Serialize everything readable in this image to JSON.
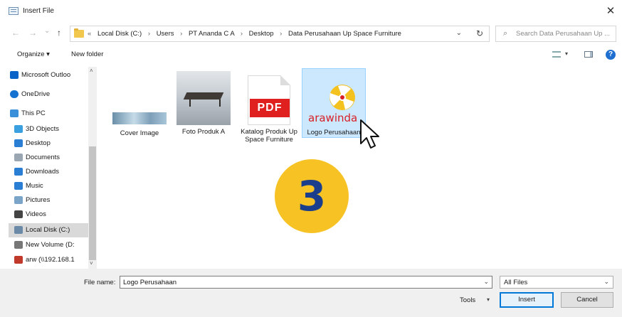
{
  "window": {
    "title": "Insert File",
    "close_glyph": "✕"
  },
  "nav": {
    "back_glyph": "←",
    "forward_glyph": "→",
    "recent_glyph": "⌄",
    "up_glyph": "↑",
    "address": {
      "overflow": "«",
      "crumbs": [
        "Local Disk (C:)",
        "Users",
        "PT Ananda C A",
        "Desktop",
        "Data Perusahaan Up Space Furniture"
      ],
      "separator": "›",
      "dropdown_glyph": "⌄",
      "refresh_glyph": "↻"
    },
    "search": {
      "placeholder": "Search Data Perusahaan Up ...",
      "icon_glyph": "⌕"
    }
  },
  "toolbar": {
    "organize_label": "Organize ▾",
    "new_folder_label": "New folder",
    "view_dd_glyph": "▾",
    "help_glyph": "?"
  },
  "sidebar": {
    "items": [
      {
        "label": "Microsoft Outloo",
        "icon": "outlook-icon",
        "color": "#0a64c8"
      },
      {
        "label": "OneDrive",
        "icon": "onedrive-icon",
        "color": "#1572d0"
      },
      {
        "label": "This PC",
        "icon": "pc-icon",
        "color": "#3a8fd9"
      },
      {
        "label": "3D Objects",
        "icon": "3d-objects-icon",
        "color": "#3aa0e0"
      },
      {
        "label": "Desktop",
        "icon": "desktop-icon",
        "color": "#2a7fd4"
      },
      {
        "label": "Documents",
        "icon": "documents-icon",
        "color": "#9aa7b3"
      },
      {
        "label": "Downloads",
        "icon": "downloads-icon",
        "color": "#2a7fd4"
      },
      {
        "label": "Music",
        "icon": "music-icon",
        "color": "#2a7fd4"
      },
      {
        "label": "Pictures",
        "icon": "pictures-icon",
        "color": "#7aa4c8"
      },
      {
        "label": "Videos",
        "icon": "videos-icon",
        "color": "#444444"
      },
      {
        "label": "Local Disk (C:)",
        "icon": "local-disk-icon",
        "color": "#6a8aa8",
        "selected": true
      },
      {
        "label": "New Volume (D:",
        "icon": "drive-icon",
        "color": "#777777"
      },
      {
        "label": "arw (\\\\192.168.1",
        "icon": "network-drive-icon",
        "color": "#c0392b"
      }
    ],
    "scroll_up_glyph": "˄",
    "scroll_down_glyph": "˅"
  },
  "files": [
    {
      "name": "Cover Image",
      "type": "image-strip"
    },
    {
      "name": "Foto Produk A",
      "type": "photo"
    },
    {
      "name": "Katalog Produk Up Space Furniture",
      "type": "pdf",
      "badge": "PDF"
    },
    {
      "name": "Logo Perusahaan",
      "type": "logo",
      "selected": true,
      "brand_text": "arawinda"
    }
  ],
  "overlay": {
    "step_number": "3"
  },
  "footer": {
    "file_name_label": "File name:",
    "file_name_value": "Logo Perusahaan",
    "dropdown_glyph": "⌄",
    "file_type_value": "All Files",
    "tools_label": "Tools",
    "tools_dd_glyph": "▾",
    "insert_label": "Insert",
    "cancel_label": "Cancel"
  },
  "colors": {
    "accent": "#0078d7",
    "selection": "#cce8ff",
    "step_badge": "#f7c324",
    "step_text": "#1a3e8c",
    "pdf_red": "#e01f1f",
    "brand_red": "#d81f26"
  }
}
